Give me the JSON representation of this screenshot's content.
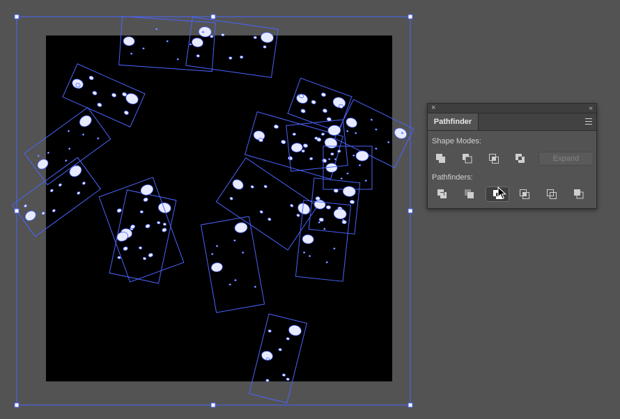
{
  "pathfinder_panel": {
    "close_glyph": "×",
    "collapse_glyph": "‹‹",
    "tab_label": "Pathfinder",
    "menu_icon": "hamburger-menu-icon",
    "shape_modes_label": "Shape Modes:",
    "shape_mode_buttons": [
      "unite-icon",
      "minus-front-icon",
      "intersect-icon",
      "exclude-icon"
    ],
    "expand_label": "Expand",
    "pathfinders_label": "Pathfinders:",
    "pathfinder_buttons": [
      "divide-icon",
      "trim-icon",
      "merge-icon",
      "crop-icon",
      "outline-icon",
      "minus-back-icon"
    ],
    "active_pathfinder": "merge-icon"
  },
  "canvas": {
    "background": "#535353",
    "artboard_fill": "#000000",
    "selection_color": "#4a64ff",
    "splatter_fill": "#e8ebff"
  }
}
